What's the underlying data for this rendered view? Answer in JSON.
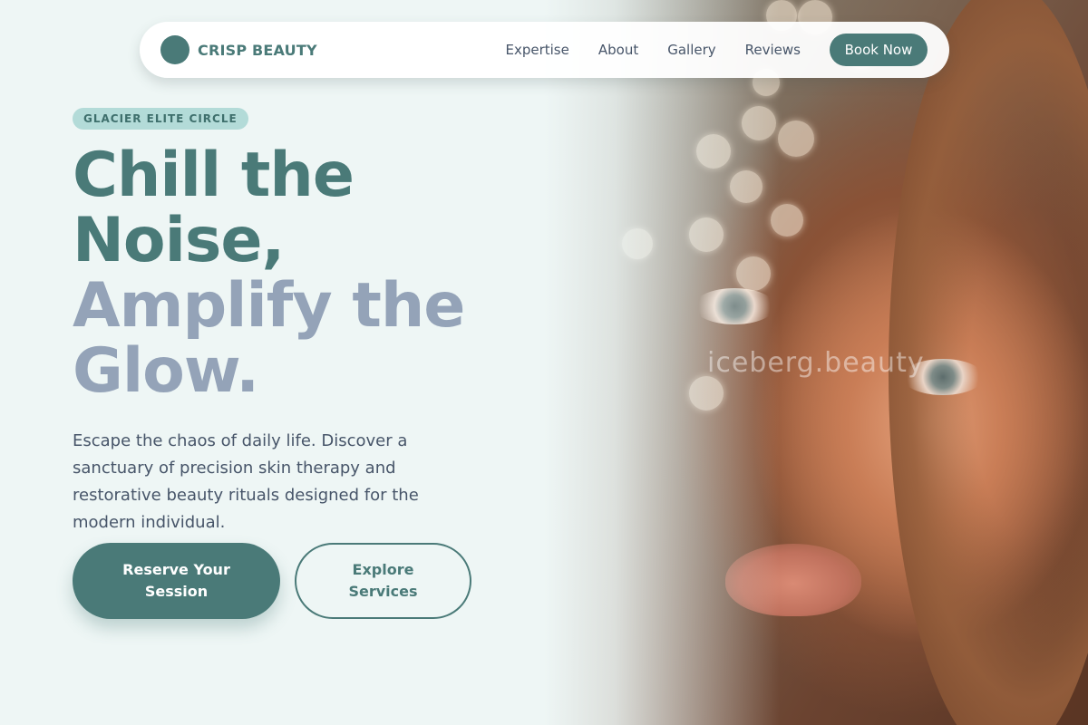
{
  "brand": {
    "name": "CRISP BEAUTY"
  },
  "nav": {
    "links": [
      "Expertise",
      "About",
      "Gallery",
      "Reviews"
    ],
    "cta": "Book Now"
  },
  "hero": {
    "badge": "GLACIER ELITE CIRCLE",
    "headline_line1": "Chill the Noise,",
    "headline_line2": "Amplify the Glow.",
    "intro": "Escape the chaos of daily life. Discover a sanctuary of precision skin therapy and restorative beauty rituals designed for the modern individual.",
    "primary_button": "Reserve Your Session",
    "secondary_button": "Explore Services",
    "image_watermark": "iceberg.beauty"
  },
  "colors": {
    "accent": "#4a7a78",
    "accent_light": "#b3dbd8",
    "muted_headline": "#94a3b8",
    "background": "#eef6f5"
  }
}
